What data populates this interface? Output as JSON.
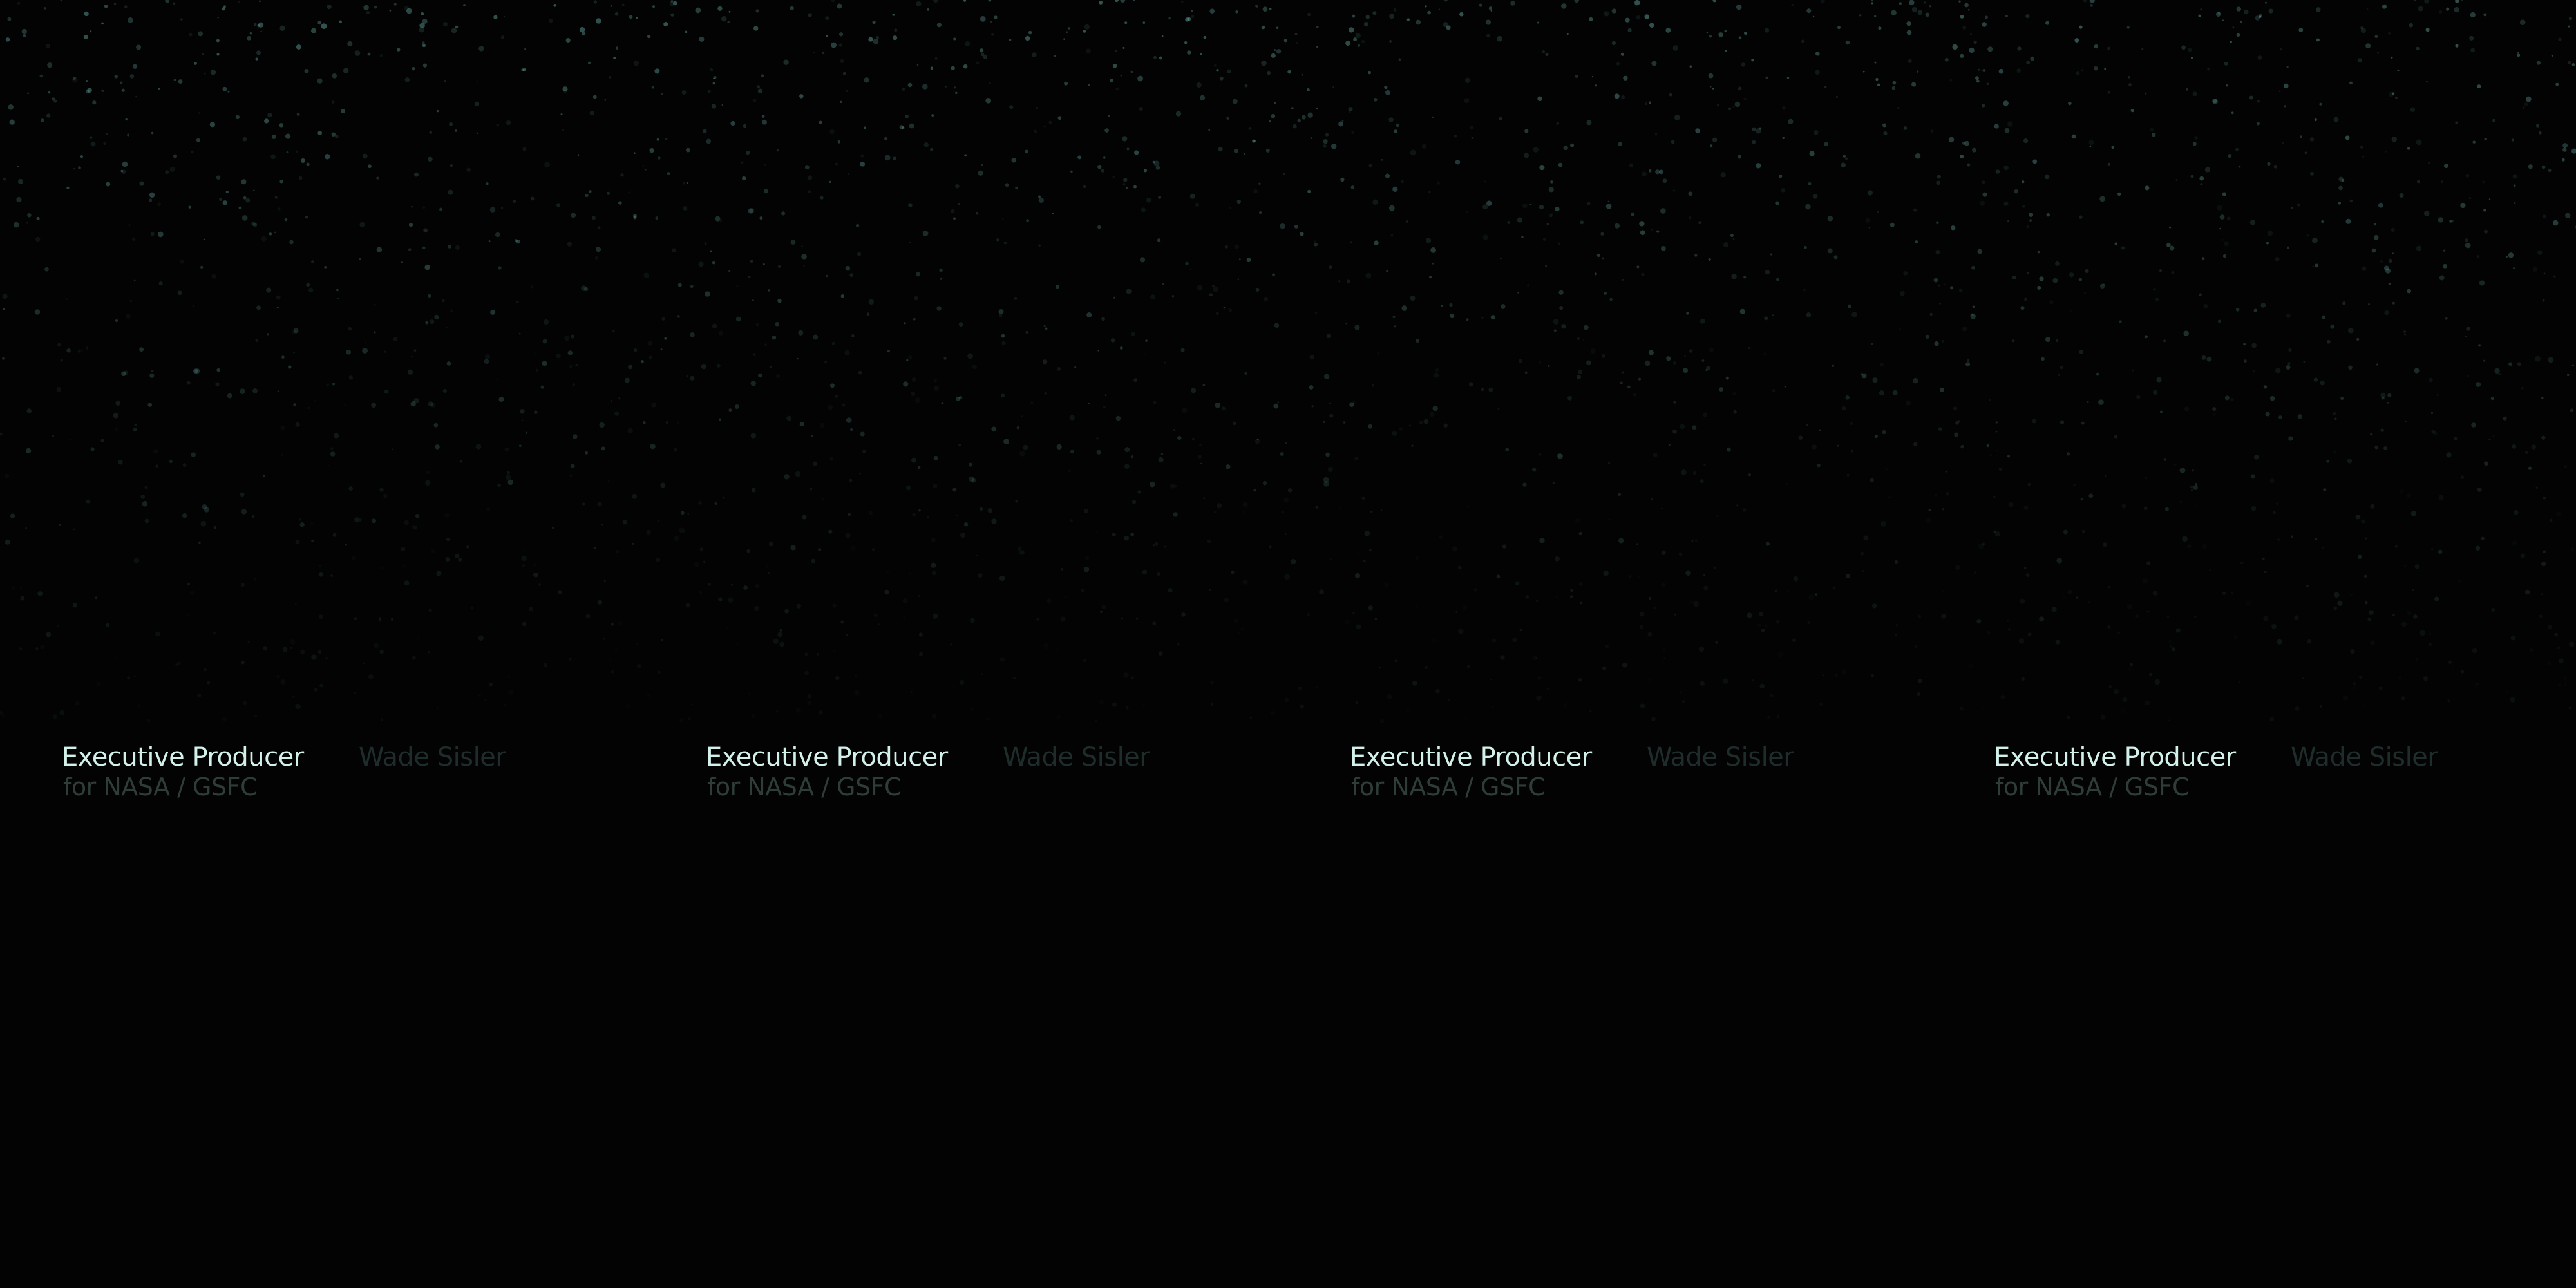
{
  "credits": [
    {
      "role": "Executive Producer",
      "org": "for NASA / GSFC",
      "person": "Wade Sisler"
    },
    {
      "role": "Executive Producer",
      "org": "for NASA / GSFC",
      "person": "Wade Sisler"
    },
    {
      "role": "Executive Producer",
      "org": "for NASA / GSFC",
      "person": "Wade Sisler"
    },
    {
      "role": "Executive Producer",
      "org": "for NASA / GSFC",
      "person": "Wade Sisler"
    }
  ],
  "colors": {
    "background": "#030303",
    "star": "#6fb7b0",
    "role_text": "#d2f1ea",
    "org_text": "#2f3d3a",
    "person_text": "#1f2c2c"
  }
}
